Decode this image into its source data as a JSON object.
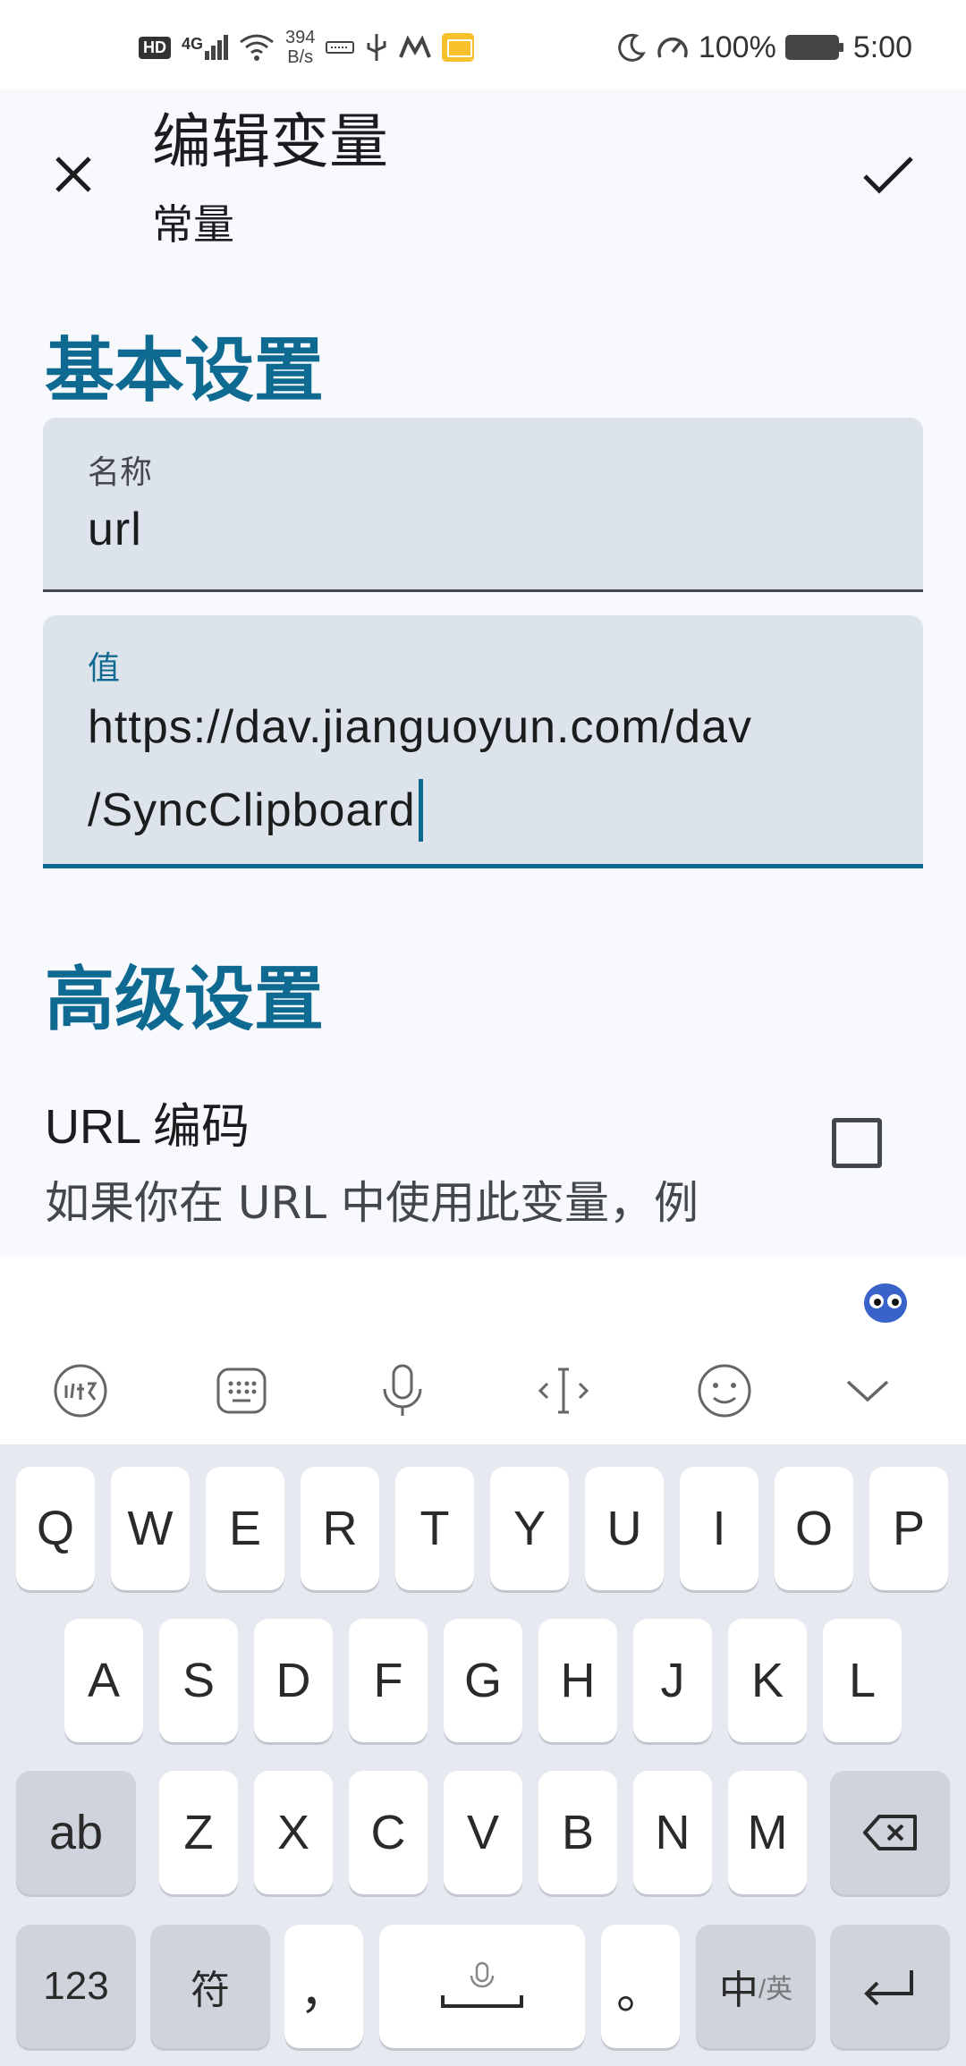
{
  "status_bar": {
    "hd": "HD",
    "signal": "4G",
    "net_speed_value": "394",
    "net_speed_unit": "B/s",
    "battery": "100%",
    "time": "5:00"
  },
  "app_bar": {
    "title": "编辑变量",
    "subtitle": "常量",
    "close_icon": "close-icon",
    "confirm_icon": "check-icon"
  },
  "basic": {
    "section_title": "基本设置",
    "name_label": "名称",
    "name_value": "url",
    "value_label": "值",
    "value_line1": "https://dav.jianguoyun.com/dav",
    "value_line2": "/SyncClipboard"
  },
  "advanced": {
    "section_title": "高级设置",
    "url_encode_title": "URL 编码",
    "url_encode_desc": "如果你在 URL 中使用此变量，例如，作为查询字符串的一部分",
    "url_encode_checked": false
  },
  "keyboard": {
    "toolbar_icons": [
      "ifly-icon",
      "keyboard-icon",
      "microphone-icon",
      "cursor-icon",
      "emoji-icon",
      "chevron-down-icon"
    ],
    "row1": [
      "Q",
      "W",
      "E",
      "R",
      "T",
      "Y",
      "U",
      "I",
      "O",
      "P"
    ],
    "row2": [
      "A",
      "S",
      "D",
      "F",
      "G",
      "H",
      "J",
      "K",
      "L"
    ],
    "row3_left": "ab",
    "row3": [
      "Z",
      "X",
      "C",
      "V",
      "B",
      "N",
      "M"
    ],
    "row4_num": "123",
    "row4_sym": "符",
    "row4_comma": "，",
    "row4_period": "。",
    "row4_lang_main": "中",
    "row4_lang_sub": "/英"
  }
}
